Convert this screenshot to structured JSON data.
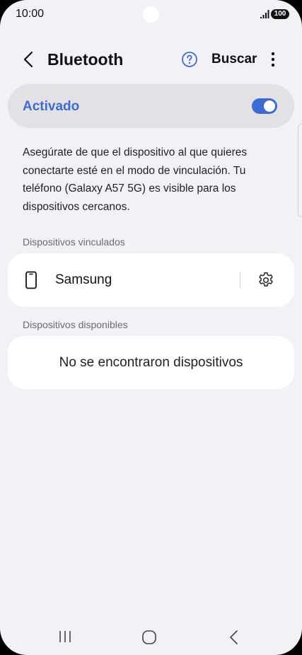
{
  "status_bar": {
    "time": "10:00",
    "battery": "100",
    "icons": [
      "signal-icon",
      "battery-icon"
    ]
  },
  "app_bar": {
    "title": "Bluetooth",
    "search_label": "Buscar",
    "icons": [
      "back-icon",
      "help-icon",
      "more-vert-icon"
    ]
  },
  "toggle": {
    "label": "Activado",
    "state": "on",
    "accent_color": "#3e6ad3"
  },
  "description": "Asegúrate de que el dispositivo al que quieres conectarte esté en el modo de vinculación. Tu teléfono (Galaxy A57 5G) es visible para los dispositivos cercanos.",
  "paired": {
    "header": "Dispositivos vinculados",
    "devices": [
      {
        "name": "Samsung",
        "icon": "phone-icon"
      }
    ]
  },
  "available": {
    "header": "Dispositivos disponibles",
    "empty_text": "No se encontraron dispositivos"
  },
  "nav_bar": {
    "icons": [
      "recents-icon",
      "home-icon",
      "back-nav-icon"
    ]
  }
}
